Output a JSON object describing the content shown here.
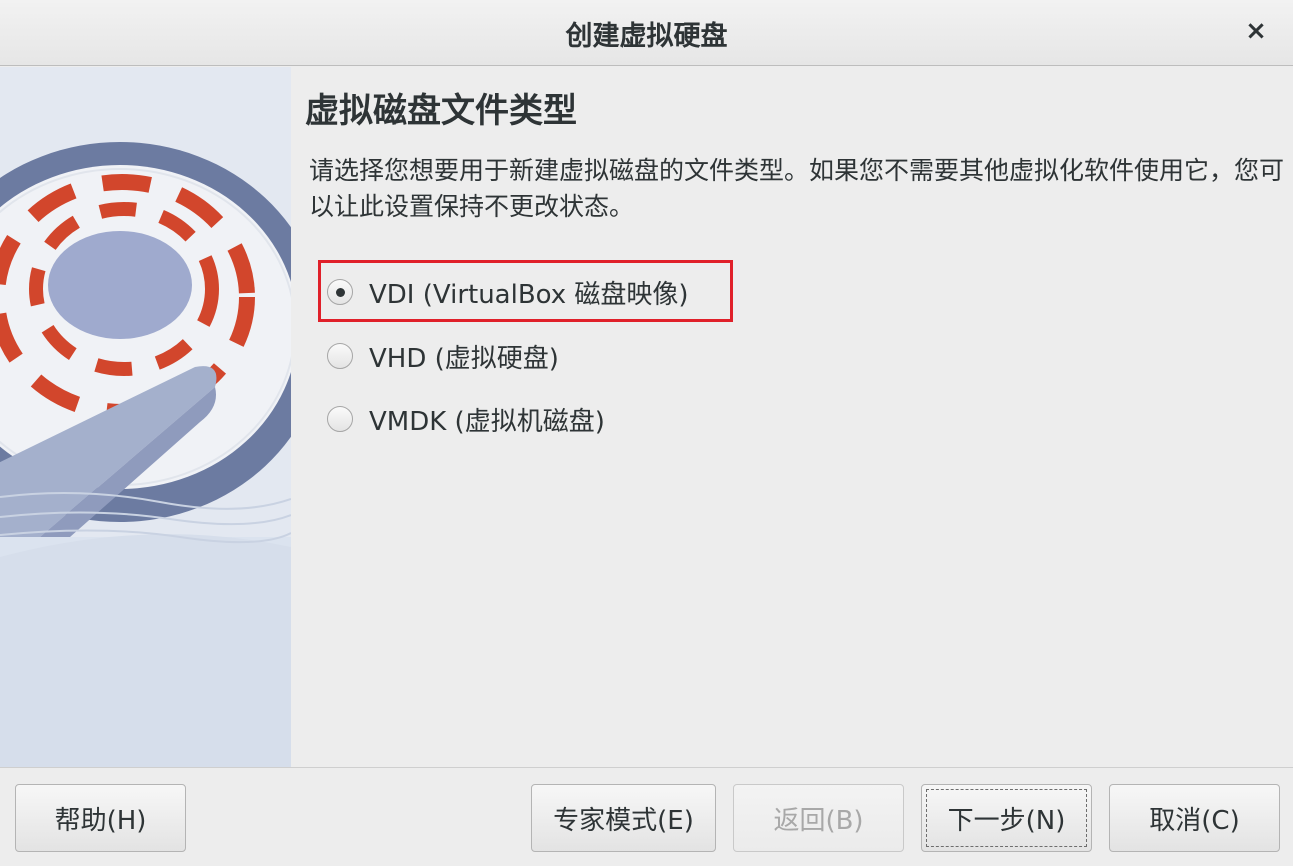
{
  "window": {
    "title": "创建虚拟硬盘",
    "close_icon": "×"
  },
  "page": {
    "title": "虚拟磁盘文件类型",
    "description": "请选择您想要用于新建虚拟磁盘的文件类型。如果您不需要其他虚拟化软件使用它，您可以让此设置保持不更改状态。"
  },
  "options": [
    {
      "label": "VDI (VirtualBox 磁盘映像)",
      "checked": true
    },
    {
      "label": "VHD (虚拟硬盘)",
      "checked": false
    },
    {
      "label": "VMDK (虚拟机磁盘)",
      "checked": false
    }
  ],
  "buttons": {
    "help": "帮助(H)",
    "expert": "专家模式(E)",
    "back": "返回(B)",
    "next": "下一步(N)",
    "cancel": "取消(C)"
  },
  "colors": {
    "highlight": "#e0202a",
    "disk_red": "#d2462c",
    "disk_blue": "#6c7ba1"
  }
}
